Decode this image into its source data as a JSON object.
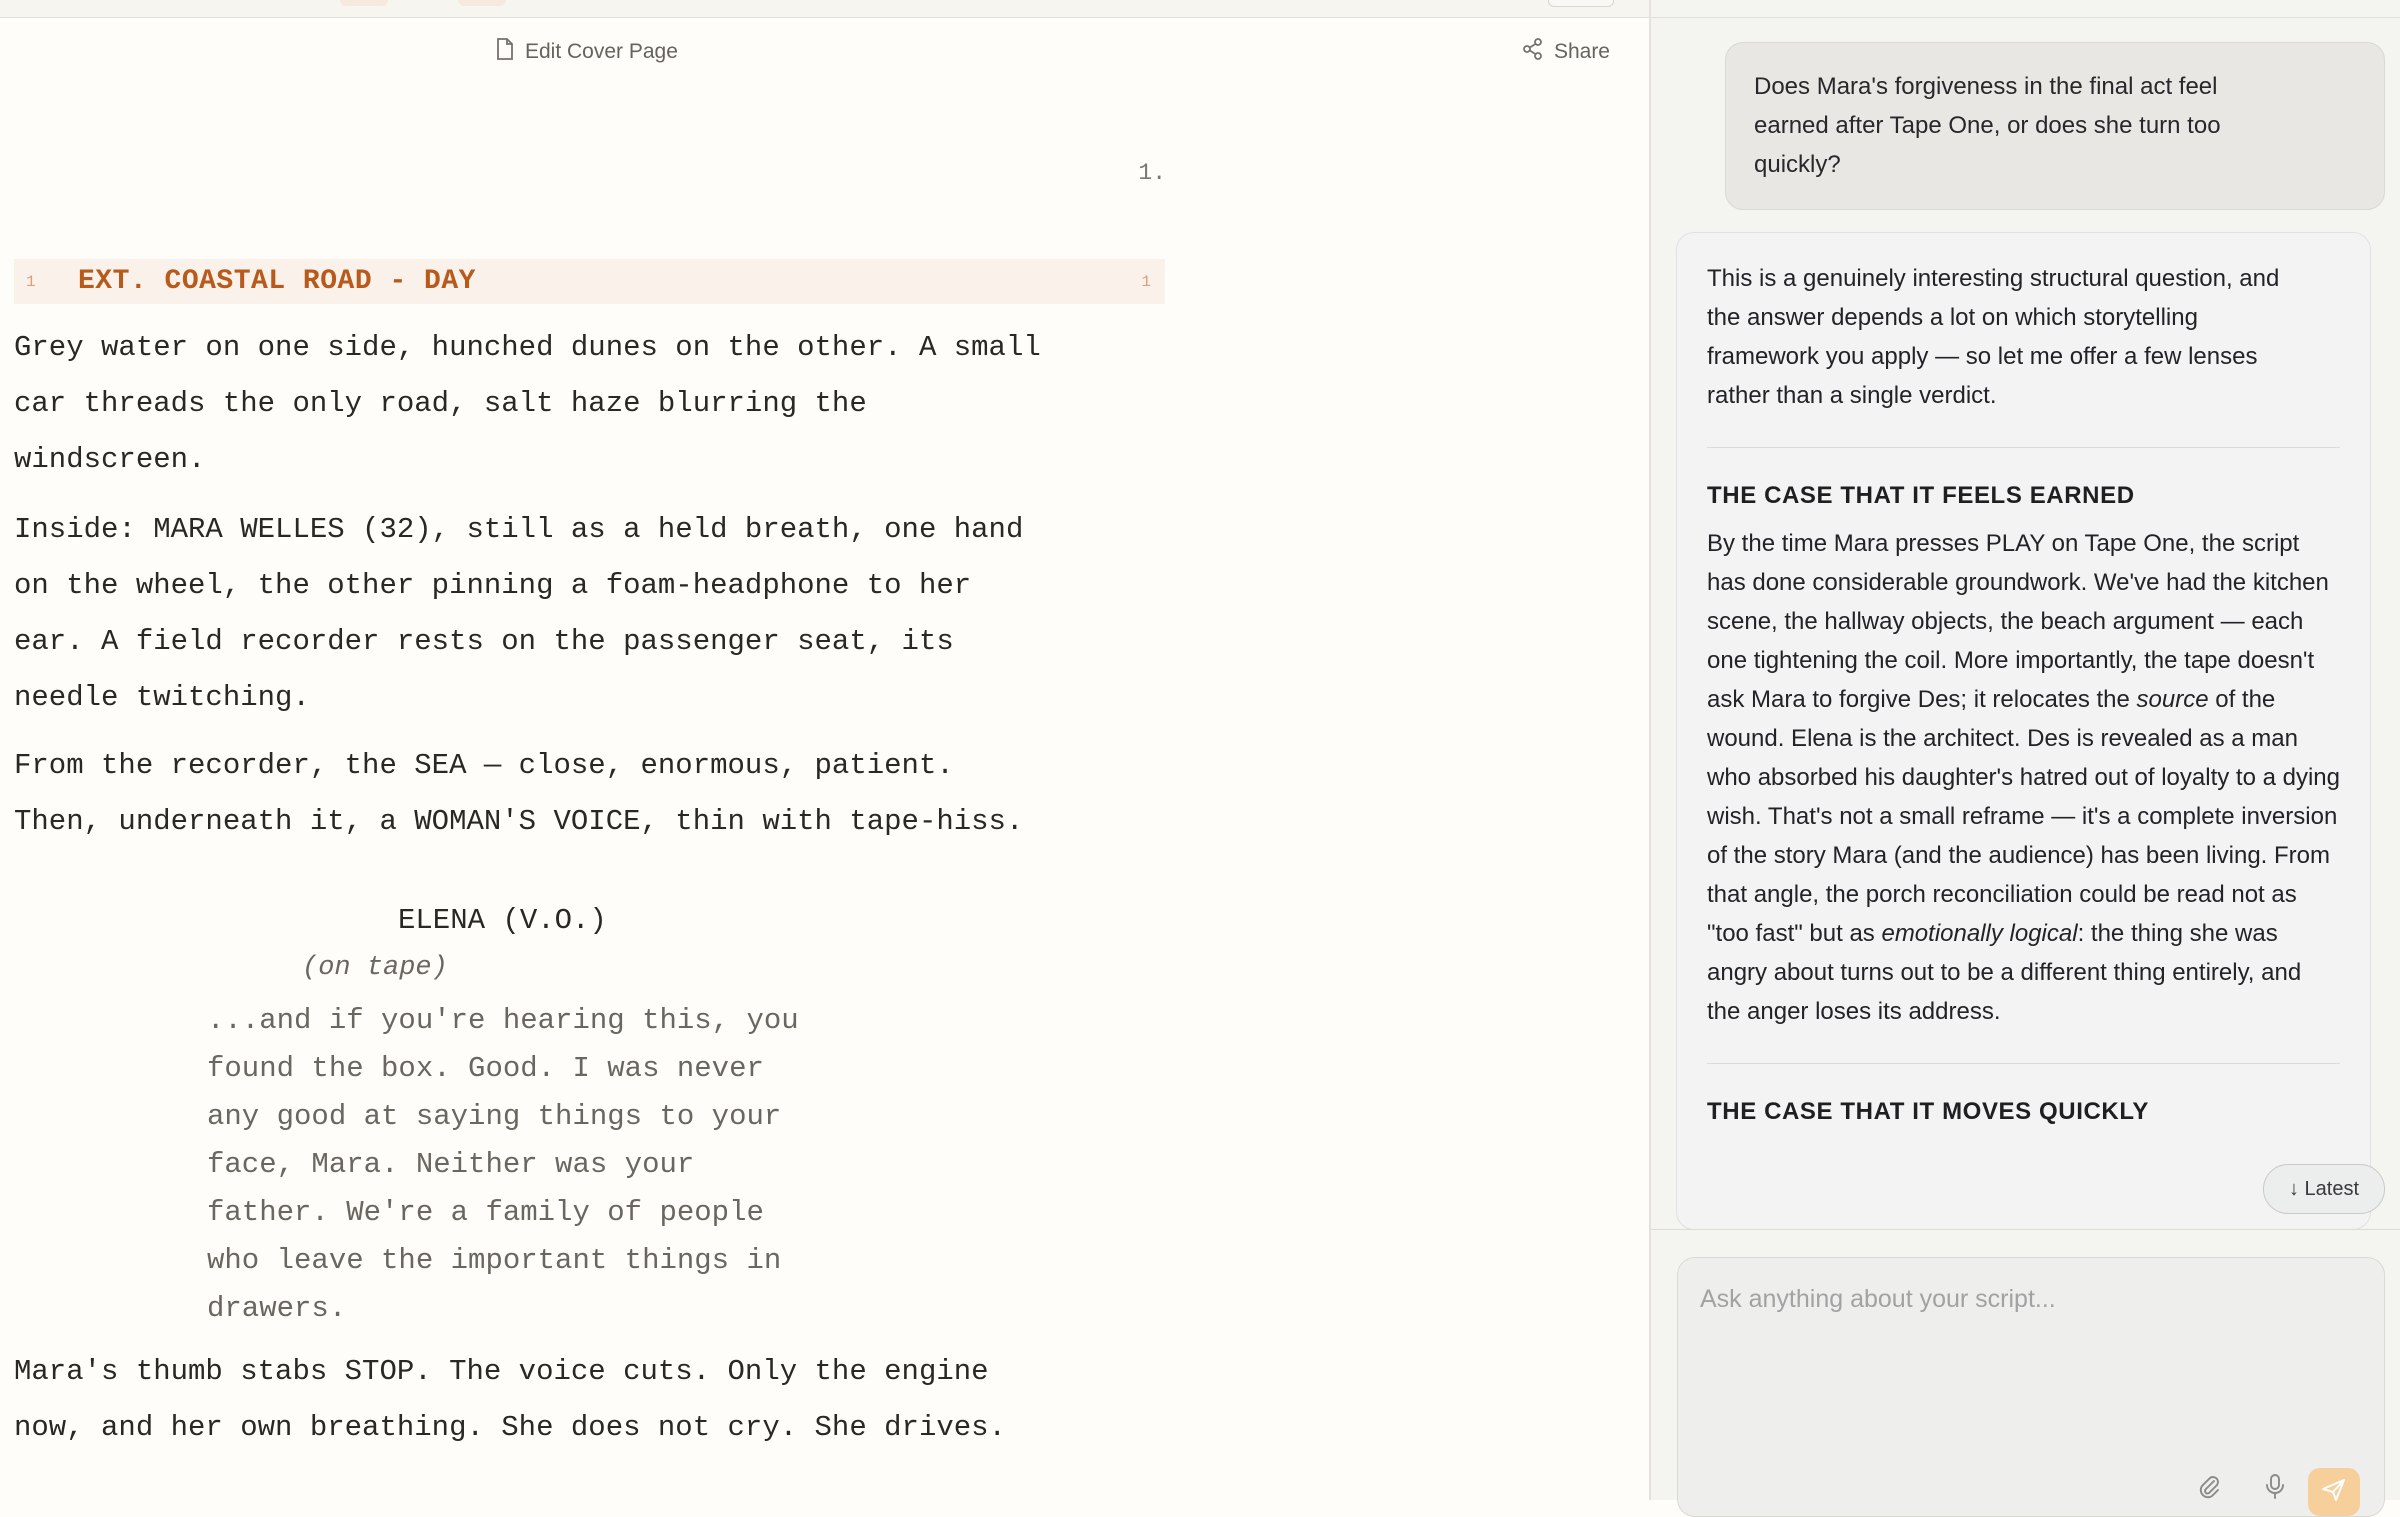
{
  "editor": {
    "toolbar": {
      "edit_cover_label": "Edit Cover Page",
      "share_label": "Share"
    },
    "page_number": "1.",
    "scene": {
      "number": "1",
      "heading": "EXT. COASTAL ROAD - DAY"
    },
    "action_1": [
      "Grey water on one side, hunched dunes on the other. A small",
      "car threads the only road, salt haze blurring the",
      "windscreen."
    ],
    "action_2": [
      "Inside: MARA WELLES (32), still as a held breath, one hand",
      "on the wheel, the other pinning a foam-headphone to her",
      "ear. A field recorder rests on the passenger seat, its",
      "needle twitching."
    ],
    "action_3": [
      "From the recorder, the SEA — close, enormous, patient.",
      "Then, underneath it, a WOMAN'S VOICE, thin with tape-hiss."
    ],
    "character": "ELENA (V.O.)",
    "parenthetical": "(on tape)",
    "dialogue": [
      "...and if you're hearing this, you",
      "found the box. Good. I was never",
      "any good at saying things to your",
      "face, Mara. Neither was your",
      "father. We're a family of people",
      "who leave the important things in",
      "drawers."
    ],
    "action_4": [
      "Mara's thumb stabs STOP. The voice cuts. Only the engine",
      "now, and her own breathing. She does not cry. She drives."
    ]
  },
  "chat": {
    "user_message": "Does Mara's forgiveness in the final act feel earned after Tape One, or does she turn too quickly?",
    "assistant": {
      "intro": "This is a genuinely interesting structural question, and the answer depends a lot on which storytelling framework you apply — so let me offer a few lenses rather than a single verdict.",
      "section_1_title": "THE CASE THAT IT FEELS EARNED",
      "section_1_part_a": "By the time Mara presses PLAY on Tape One, the script has done considerable groundwork. We've had the kitchen scene, the hallway objects, the beach argument — each one tightening the coil. More importantly, the tape doesn't ask Mara to forgive Des; it relocates the ",
      "section_1_em_1": "source",
      "section_1_part_b": " of the wound. Elena is the architect. Des is revealed as a man who absorbed his daughter's hatred out of loyalty to a dying wish. That's not a small reframe — it's a complete inversion of the story Mara (and the audience) has been living. From that angle, the porch reconciliation could be read not as \"too fast\" but as ",
      "section_1_em_2": "emotionally logical",
      "section_1_part_c": ": the thing she was angry about turns out to be a different thing entirely, and the anger loses its address.",
      "section_2_title": "THE CASE THAT IT MOVES QUICKLY"
    },
    "latest_label": "↓ Latest",
    "composer_placeholder": "Ask anything about your script..."
  },
  "icons": {
    "document": "document-icon",
    "share": "share-icon",
    "attach": "paperclip-icon",
    "mic": "microphone-icon",
    "send": "send-icon"
  },
  "colors": {
    "scene_heading_text": "#b85a1c",
    "scene_heading_bg": "#faf1ea",
    "send_button": "#f6cf9a"
  }
}
